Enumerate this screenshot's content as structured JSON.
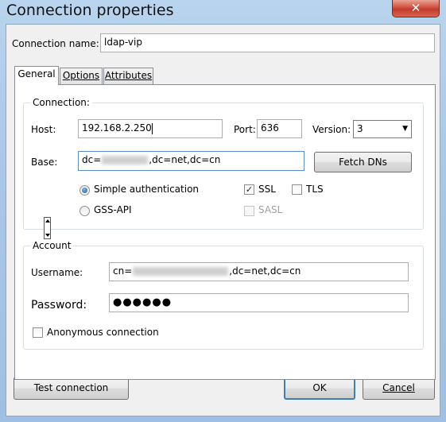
{
  "window": {
    "title": "Connection properties",
    "close_glyph": "✕"
  },
  "connection_name": {
    "label": "Connection name:",
    "value": "ldap-vip"
  },
  "tabs": [
    {
      "label": "General",
      "active": true
    },
    {
      "label": "Options",
      "active": false
    },
    {
      "label": "Attributes",
      "active": false
    }
  ],
  "connection": {
    "title": "Connection:",
    "host_label": "Host:",
    "host_value": "192.168.2.250",
    "port_label": "Port:",
    "port_value": "636",
    "version_label": "Version:",
    "version_value": "3",
    "base_label": "Base:",
    "base_prefix": "dc=",
    "base_suffix": ",dc=net,dc=cn",
    "fetch_label": "Fetch DNs",
    "simple_auth_label": "Simple authentication",
    "simple_auth_selected": true,
    "gssapi_label": "GSS-API",
    "gssapi_selected": false,
    "ssl_label": "SSL",
    "ssl_checked": true,
    "tls_label": "TLS",
    "tls_checked": false,
    "sasl_label": "SASL",
    "sasl_checked": false
  },
  "account": {
    "title": "Account",
    "username_label": "Username:",
    "username_prefix": "cn=",
    "username_suffix": ",dc=net,dc=cn",
    "password_label": "Password:",
    "password_mask": "●●●●●●",
    "anonymous_label": "Anonymous connection",
    "anonymous_checked": false
  },
  "buttons": {
    "test": "Test connection",
    "ok": "OK",
    "cancel": "Cancel"
  },
  "icons": {
    "check": "✓",
    "dropdown": "▼"
  }
}
